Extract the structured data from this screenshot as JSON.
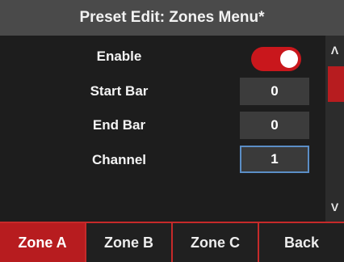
{
  "title": "Preset Edit: Zones Menu*",
  "menu": {
    "enable_label": "Enable",
    "enable_state": "on",
    "start_bar": {
      "label": "Start Bar",
      "value": "0"
    },
    "end_bar": {
      "label": "End Bar",
      "value": "0"
    },
    "channel": {
      "label": "Channel",
      "value": "1"
    }
  },
  "scrollbar": {
    "up_glyph": "Λ",
    "down_glyph": "V"
  },
  "tabs": [
    {
      "label": "Zone A",
      "active": true
    },
    {
      "label": "Zone B",
      "active": false
    },
    {
      "label": "Zone C",
      "active": false
    },
    {
      "label": "Back",
      "active": false
    }
  ],
  "colors": {
    "accent_red": "#b71c1f",
    "selection_blue": "#5b8ec6"
  }
}
